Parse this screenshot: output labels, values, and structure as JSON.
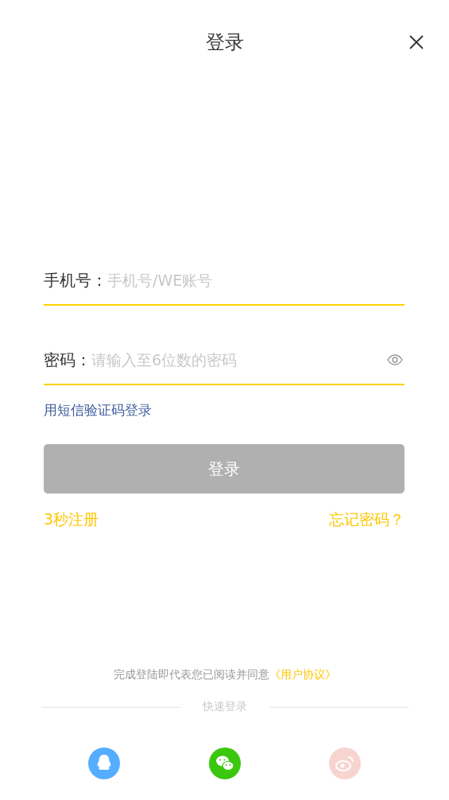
{
  "header": {
    "title": "登录"
  },
  "fields": [
    {
      "label": "手机号：",
      "placeholder": "手机号/WE账号",
      "kind": "text"
    },
    {
      "label": "密码：",
      "placeholder": "请输入至6位数的密码",
      "kind": "password"
    }
  ],
  "sms_link": "用短信验证码登录",
  "login_button": {
    "label": "登录",
    "disabled": true
  },
  "register_link": "3秒注册",
  "forgot_link": "忘记密码？",
  "agreement": {
    "text": "完成登陆即代表您已阅读并同意",
    "link": "《用户协议》"
  },
  "quick_login": {
    "title": "快速登录",
    "providers": [
      {
        "kind": "qq"
      },
      {
        "kind": "wechat"
      },
      {
        "kind": "weibo"
      }
    ]
  }
}
